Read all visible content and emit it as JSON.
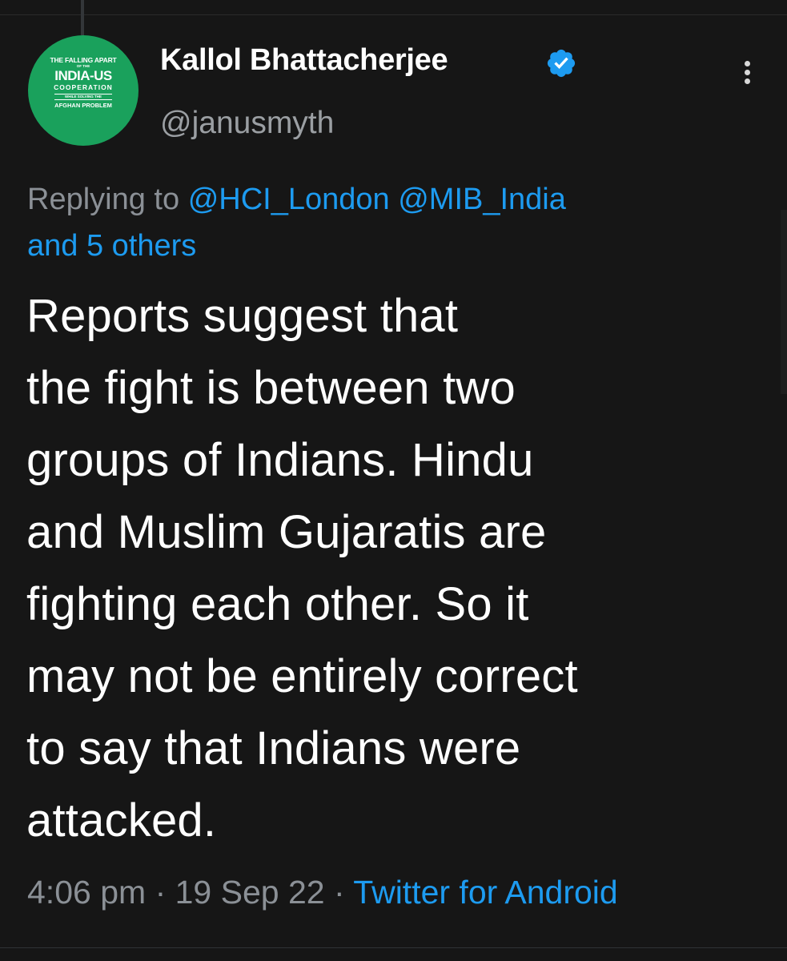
{
  "avatar": {
    "lines": [
      "THE FALLING APART",
      "OF THE",
      "INDIA-US",
      "COOPERATION",
      "WHILE SOLVING THE",
      "AFGHAN PROBLEM"
    ],
    "background": "#1aa15c"
  },
  "author": {
    "display_name": "Kallol Bhattacherjee",
    "handle": "@janusmyth",
    "verified_icon": "verified-badge-icon",
    "verified_color": "#1d9bf0"
  },
  "more_icon": "more-vertical-icon",
  "reply_context": {
    "prefix": "Replying to",
    "mentions": [
      "@HCI_London",
      "@MIB_India"
    ],
    "others": "and 5 others"
  },
  "tweet": {
    "text": "Reports suggest that\nthe fight is between two\ngroups of Indians. Hindu\nand Muslim Gujaratis are\nfighting  each other. So it\nmay not be entirely correct\nto say that Indians were\nattacked."
  },
  "meta": {
    "time": "4:06 pm",
    "separator": "·",
    "date": "19 Sep 22",
    "source": "Twitter for Android"
  },
  "colors": {
    "background": "#161616",
    "accent": "#1d9bf0",
    "secondary_text": "#8b9096"
  }
}
